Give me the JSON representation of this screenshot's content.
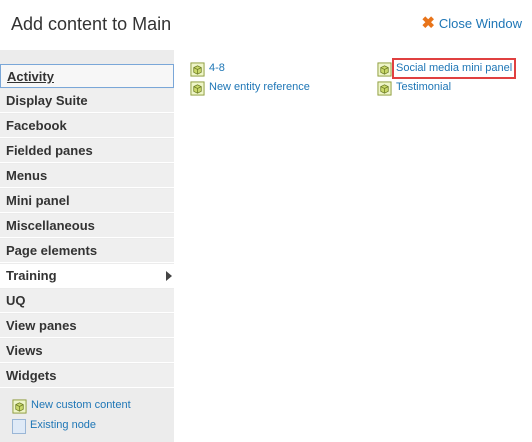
{
  "header": {
    "title": "Add content to Main",
    "close_label": "Close Window"
  },
  "sidebar": {
    "categories": [
      "Activity",
      "Display Suite",
      "Facebook",
      "Fielded panes",
      "Menus",
      "Mini panel",
      "Miscellaneous",
      "Page elements",
      "Training",
      "UQ",
      "View panes",
      "Views",
      "Widgets"
    ],
    "active": "Training",
    "focused": "Activity",
    "bottom_links": [
      "New custom content",
      "Existing node"
    ]
  },
  "content": {
    "column1": [
      "4-8",
      "New entity reference"
    ],
    "column2": [
      "Social media mini panel",
      "Testimonial"
    ],
    "highlighted": "Social media mini panel"
  },
  "colors": {
    "link": "#1e76b6",
    "highlight": "#e04040",
    "close_x": "#e8741a"
  }
}
